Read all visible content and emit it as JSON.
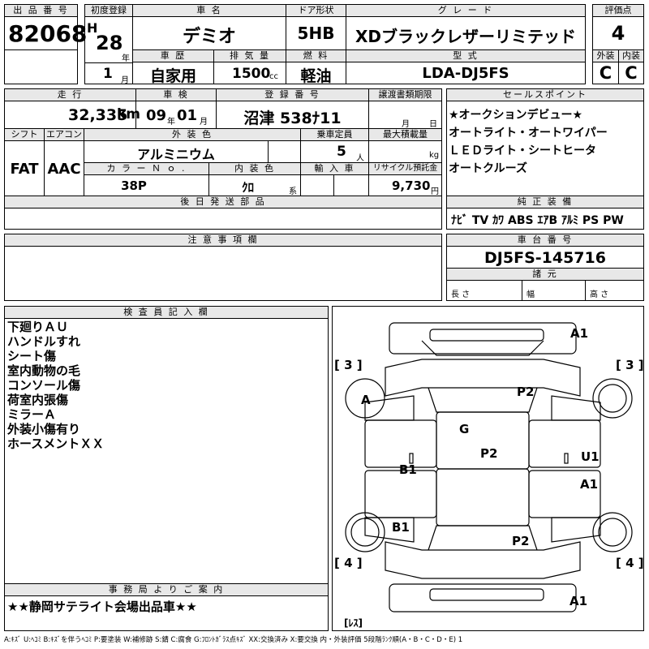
{
  "header": {
    "lot_label": "出 品 番 号",
    "lot_number": "82068",
    "first_reg_label": "初度登録",
    "era": "H",
    "year": "28",
    "year_unit": "年",
    "month": "1",
    "month_unit": "月",
    "name_label": "車 名",
    "name": "デミオ",
    "door_label": "ドア形状",
    "door": "5HB",
    "grade_label": "グ レ ー ド",
    "grade": "XDブラックレザーリミテッド",
    "score_label": "評価点",
    "score": "4",
    "history_label": "車 歴",
    "history": "自家用",
    "displacement_label": "排 気 量",
    "displacement": "1500",
    "displacement_unit": "cc",
    "fuel_label": "燃 料",
    "fuel": "軽油",
    "model_label": "型 式",
    "model": "LDA-DJ5FS",
    "exterior_label": "外装",
    "exterior": "C",
    "interior_label": "内装",
    "interior": "C"
  },
  "row2": {
    "mileage_label": "走 行",
    "mileage": "32,335",
    "mileage_unit": "km",
    "inspection_label": "車 検",
    "insp_year": "09",
    "insp_year_unit": "年",
    "insp_month": "01",
    "insp_month_unit": "月",
    "plate_label": "登 録 番 号",
    "plate": "沼津 538ﾅ11",
    "transfer_label": "譲渡書類期限",
    "transfer_month": "月",
    "transfer_day": "日",
    "sales_label": "セールスポイント",
    "sales_points": [
      "★オークションデビュー★",
      "オートライト・オートワイパー",
      "ＬＥＤライト・シートヒータ",
      "オートクルーズ"
    ]
  },
  "row3": {
    "shift_label": "シフト",
    "shift": "FAT",
    "ac_label": "エアコン",
    "ac": "AAC",
    "color_label": "外 装 色",
    "color": "アルミニウム",
    "capacity_label": "乗車定員",
    "capacity": "5",
    "capacity_unit": "人",
    "load_label": "最大積載量",
    "load_unit": "kg",
    "color_no_label": "カ ラ ー Ｎ ｏ .",
    "color_no": "38P",
    "int_color_label": "内 装 色",
    "int_color": "ｸﾛ",
    "int_color_unit": "系",
    "import_label": "輸 入 車",
    "recycle_label": "リサイクル預託金",
    "recycle": "9,730",
    "recycle_unit": "円"
  },
  "later_parts_label": "後 日 発 送 部 品",
  "equipment_label": "純 正 装 備",
  "equipment": "ﾅﾋﾞ TV ｶﾜ ABS ｴｱB ｱﾙﾐ PS PW",
  "notes_label": "注 意 事 項 欄",
  "chassis_label": "車 台 番 号",
  "chassis": "DJ5FS-145716",
  "specs_label": "諸 元",
  "length_label": "長 さ",
  "width_label": "幅",
  "height_label": "高 さ",
  "inspector_label": "検 査 員 記 入 欄",
  "inspector_notes": [
    "下廻りＡＵ",
    "ハンドルすれ",
    "シート傷",
    "室内動物の毛",
    "コンソール傷",
    "荷室内張傷",
    "ミラーＡ",
    "外装小傷有り",
    "ホースメントＸＸ"
  ],
  "office_label": "事 務 局 よ り ご 案 内",
  "office_note": "★★静岡サテライト会場出品車★★",
  "legend": "A:ｷｽﾞ U:ﾍｺﾐ B:ｷｽﾞを伴うﾍｺﾐ P:要塗装 W:補修跡 S:錆 C:腐食 G:ﾌﾛﾝﾄｶﾞﾗｽ点ｷｽﾞ XX:交換済み X:要交換 内・外装評価 5段階ﾗﾝｸ順(A・B・C・D・E) 1",
  "diagram": {
    "marks": [
      "A1",
      "P2",
      "A",
      "G",
      "P2",
      "B1",
      "U1",
      "A1",
      "B1",
      "P2",
      "A1"
    ],
    "front_left": "[ 3 ]",
    "front_right": "[ 3 ]",
    "rear_left": "[ 4 ]",
    "rear_right": "[ 4 ]",
    "bottom": "[ﾚｽ]"
  }
}
